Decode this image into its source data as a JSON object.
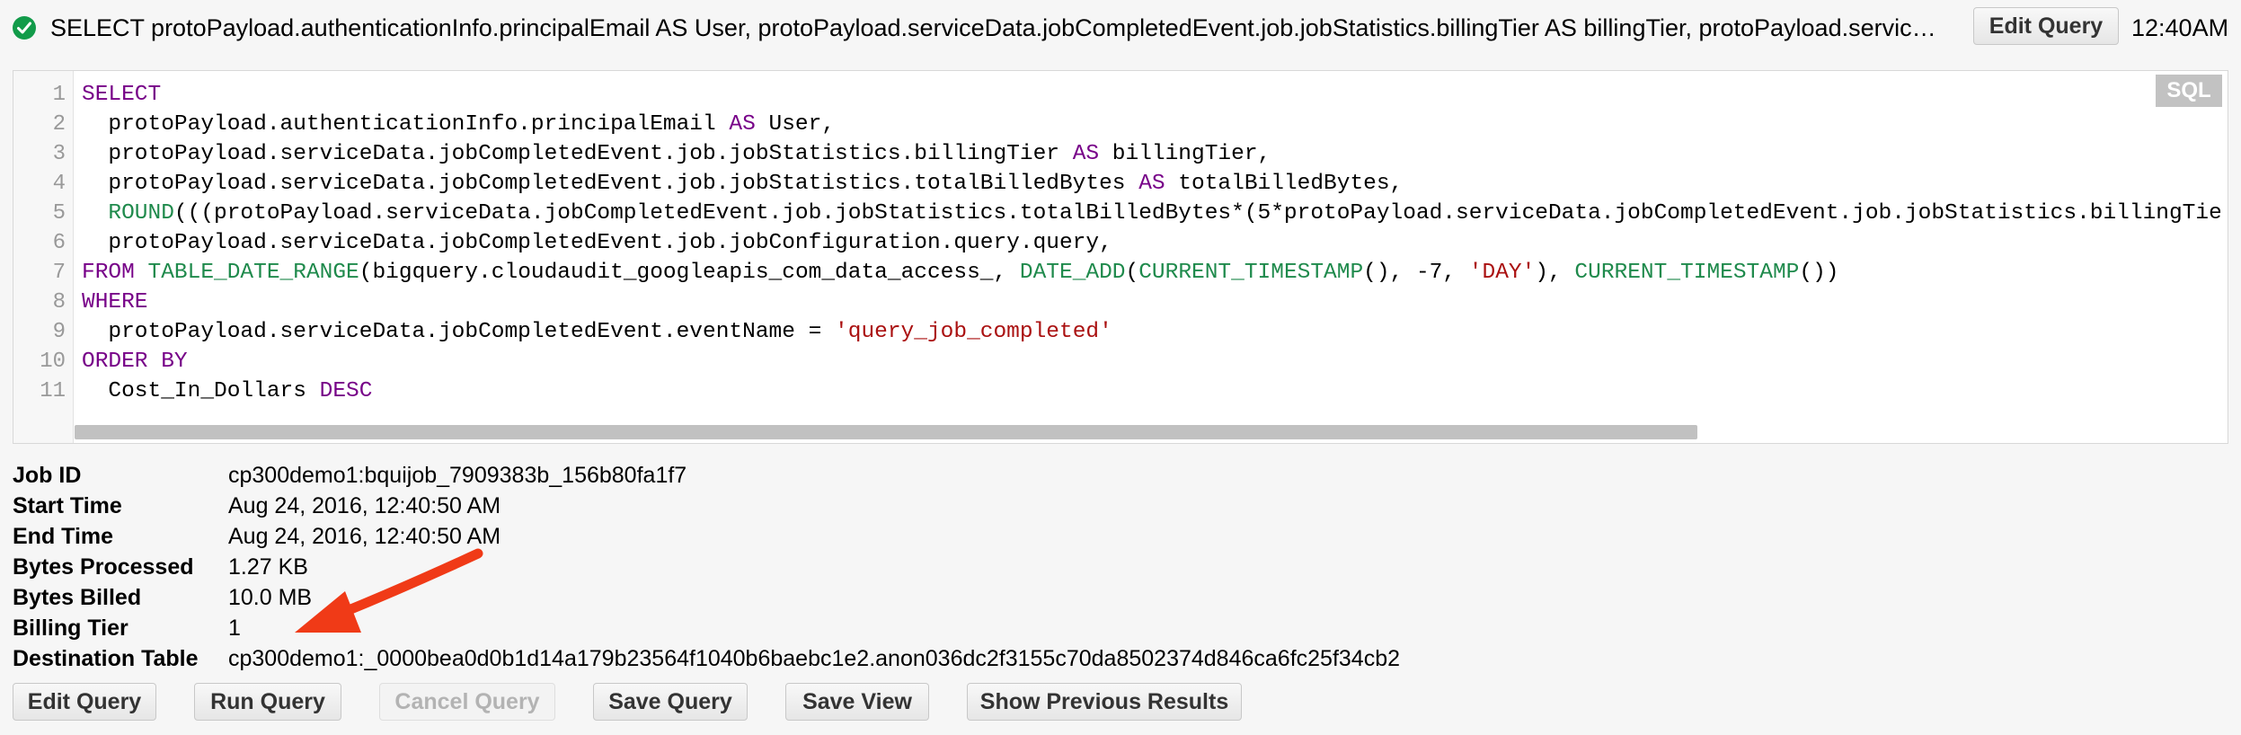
{
  "header": {
    "query_summary": "SELECT protoPayload.authenticationInfo.principalEmail AS User, protoPayload.serviceData.jobCompletedEvent.job.jobStatistics.billingTier AS billingTier, protoPayload.serviceDat...",
    "edit_label": "Edit Query",
    "time": "12:40AM"
  },
  "editor": {
    "badge": "SQL",
    "line_numbers": [
      "1",
      "2",
      "3",
      "4",
      "5",
      "6",
      "7",
      "8",
      "9",
      "10",
      "11"
    ]
  },
  "job": {
    "labels": {
      "job_id": "Job ID",
      "start_time": "Start Time",
      "end_time": "End Time",
      "bytes_processed": "Bytes Processed",
      "bytes_billed": "Bytes Billed",
      "billing_tier": "Billing Tier",
      "destination_table": "Destination Table"
    },
    "values": {
      "job_id": "cp300demo1:bquijob_7909383b_156b80fa1f7",
      "start_time": "Aug 24, 2016, 12:40:50 AM",
      "end_time": "Aug 24, 2016, 12:40:50 AM",
      "bytes_processed": "1.27 KB",
      "bytes_billed": "10.0 MB",
      "billing_tier": "1",
      "destination_table": "cp300demo1:_0000bea0d0b1d14a179b23564f1040b6baebc1e2.anon036dc2f3155c70da8502374d846ca6fc25f34cb2"
    }
  },
  "actions": {
    "edit_query": "Edit Query",
    "run_query": "Run Query",
    "cancel_query": "Cancel Query",
    "save_query": "Save Query",
    "save_view": "Save View",
    "show_previous": "Show Previous Results"
  },
  "colors": {
    "keyword": "#770088",
    "function": "#1f8a4c",
    "string": "#aa1111",
    "success": "#129b4a",
    "annotation_arrow": "#f03a17"
  }
}
